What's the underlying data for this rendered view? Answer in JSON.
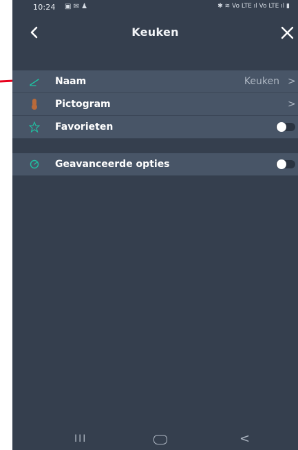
{
  "statusbar": {
    "time": "10:24",
    "left_icons": "▣ ✉ ♟",
    "right_icons": "✱ ≋ Vo LTE ıl Vo LTE ıl ▮"
  },
  "header": {
    "title": "Keuken"
  },
  "settings": {
    "name": {
      "label": "Naam",
      "value": "Keuken",
      "chevron": ">"
    },
    "icon": {
      "label": "Pictogram",
      "chevron": ">"
    },
    "favorites": {
      "label": "Favorieten",
      "enabled": false
    },
    "advanced": {
      "label": "Geavanceerde opties",
      "enabled": false
    }
  },
  "navbar": {
    "recents": "III",
    "back": "<"
  },
  "colors": {
    "background": "#353f4e",
    "row": "#485567",
    "accent_teal": "#1fc2a3",
    "icon_brown": "#b96a3a",
    "annotation_red": "#e8001c"
  }
}
